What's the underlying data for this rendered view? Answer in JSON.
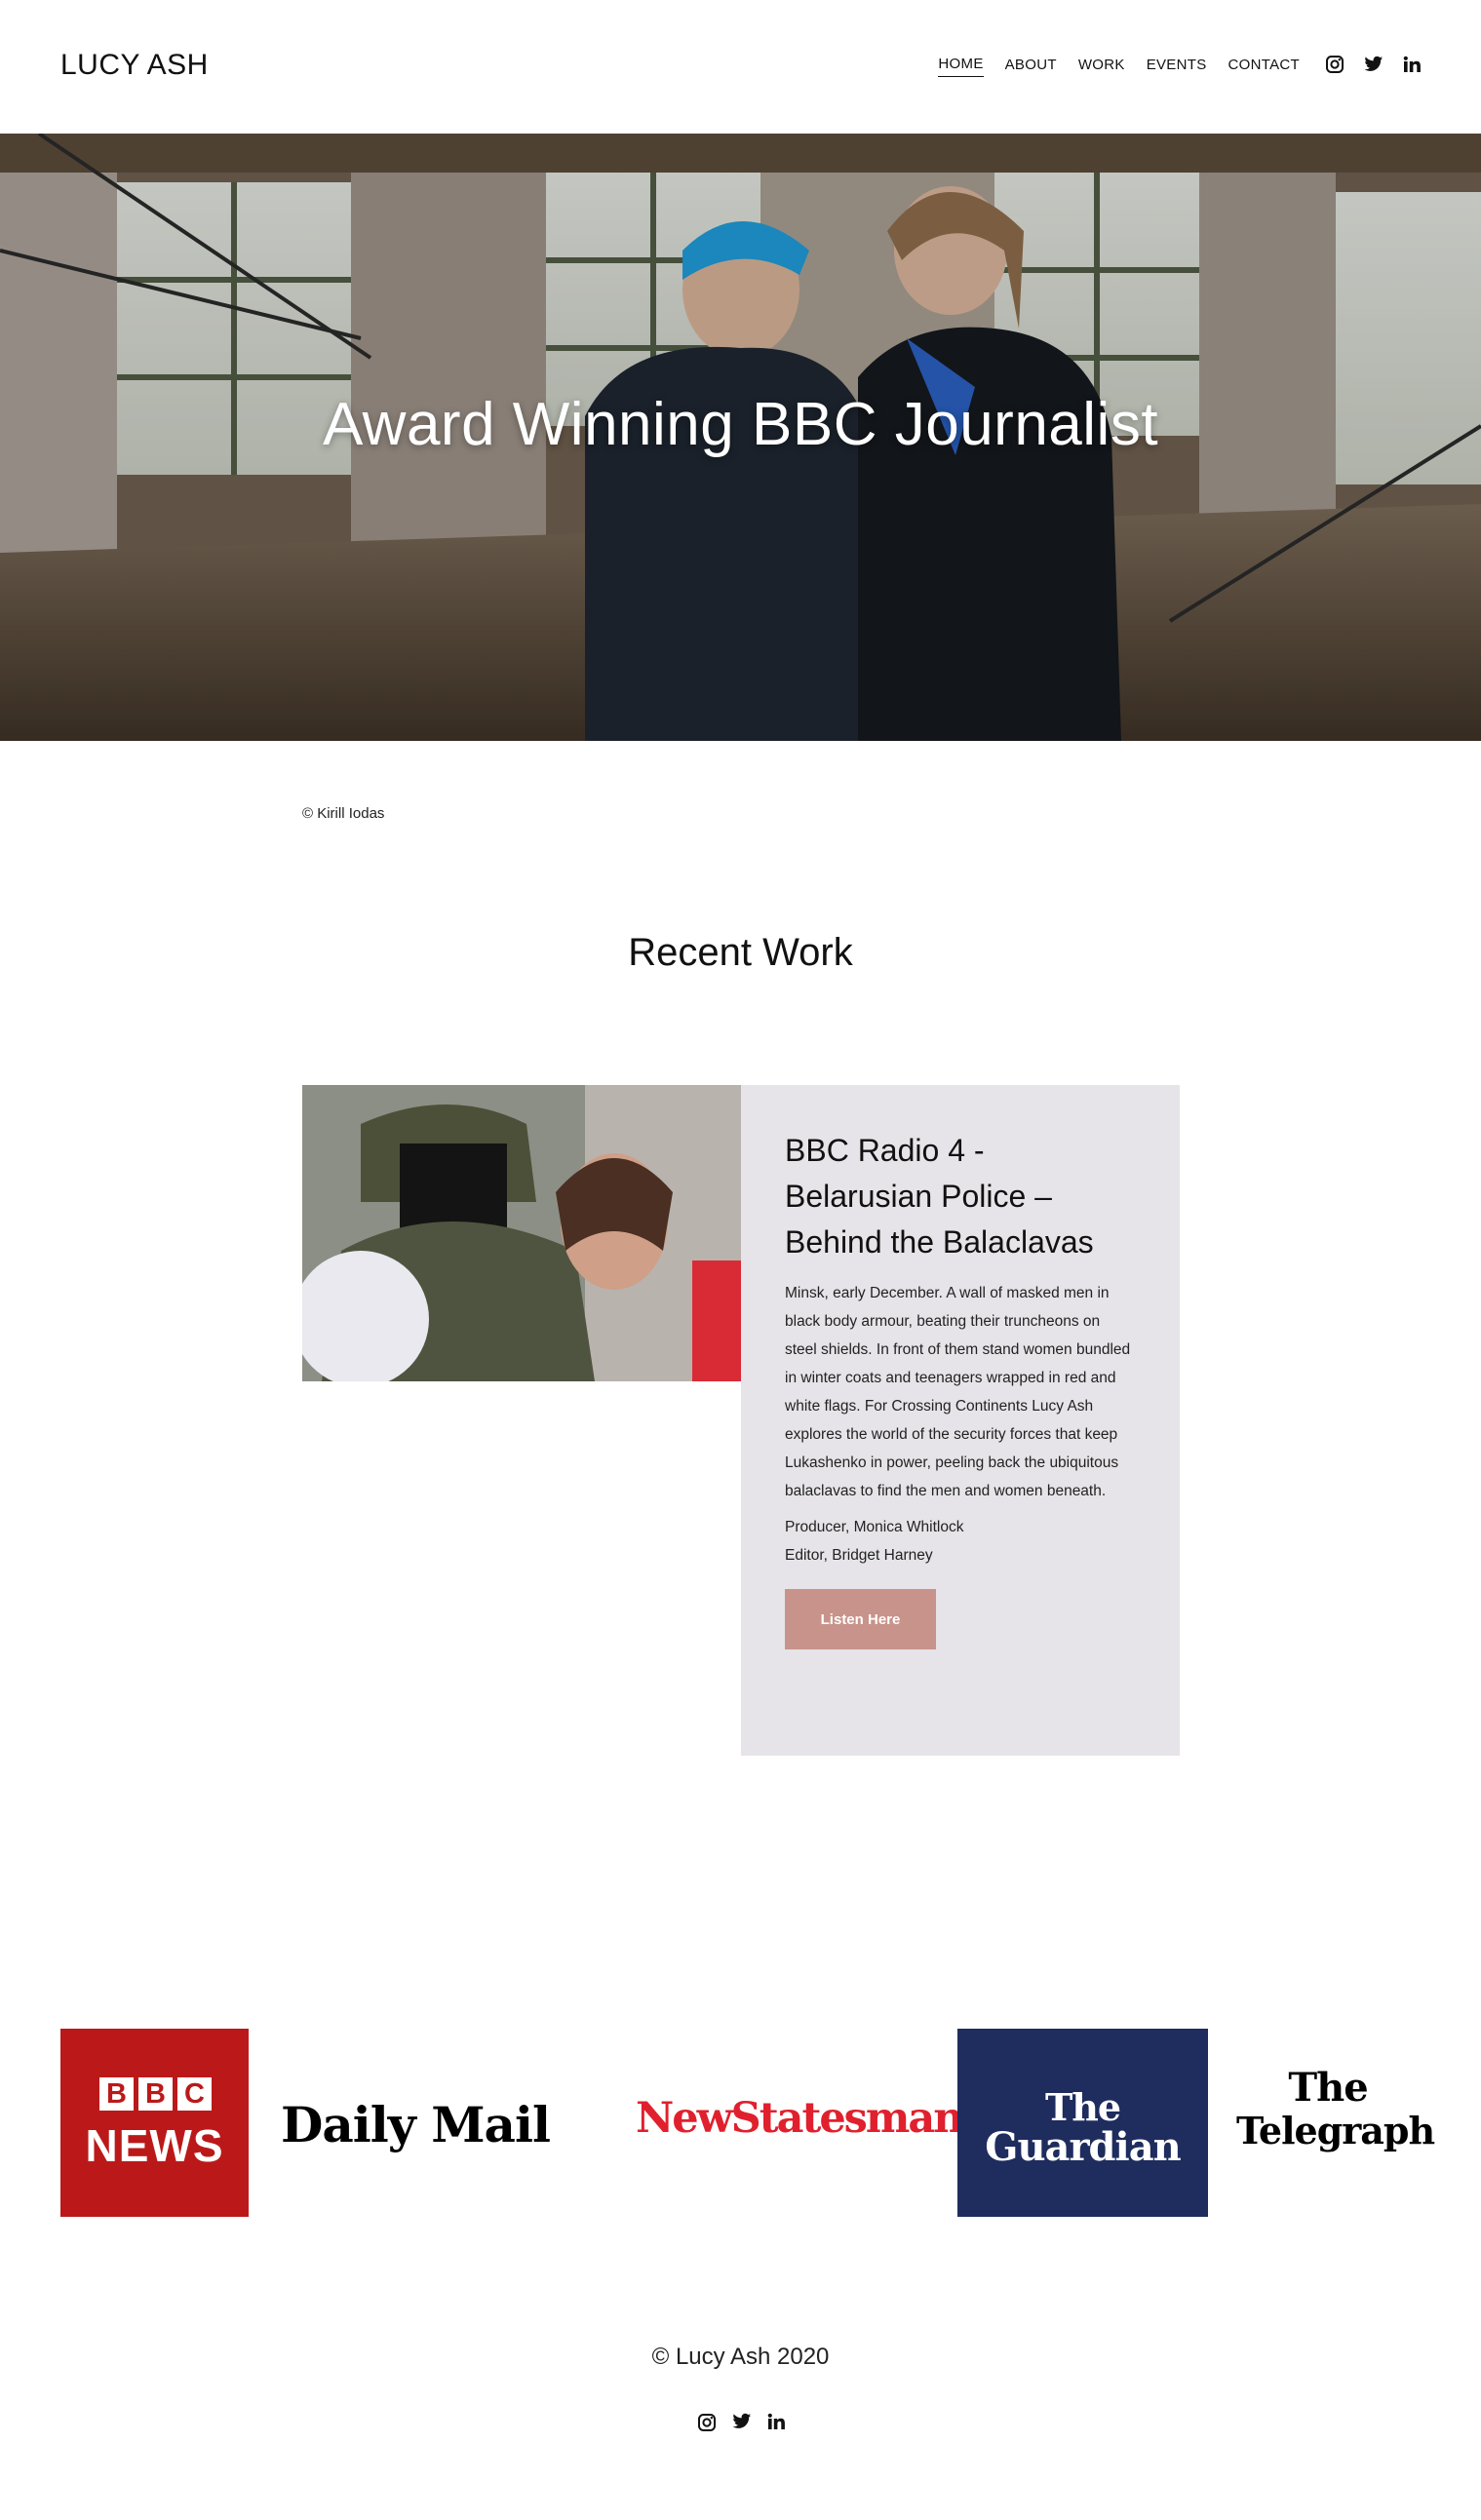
{
  "header": {
    "site_title": "LUCY ASH",
    "nav": [
      {
        "label": "HOME"
      },
      {
        "label": "ABOUT"
      },
      {
        "label": "WORK"
      },
      {
        "label": "EVENTS"
      },
      {
        "label": "CONTACT"
      }
    ],
    "social_icons": [
      "instagram-icon",
      "twitter-icon",
      "linkedin-icon"
    ]
  },
  "hero": {
    "title": "Award Winning BBC Journalist",
    "credit": "© Kirill Iodas"
  },
  "recent_work": {
    "heading": "Recent Work",
    "card": {
      "title": "BBC Radio 4 - Belarusian Police – Behind the Balaclavas",
      "description": "Minsk, early December. A wall of masked men in black body armour, beating their truncheons on steel shields. In front of them stand women bundled in winter coats and teenagers wrapped in red and white flags. For Crossing Continents Lucy Ash explores the world of the security forces that keep Lukashenko in power, peeling back the ubiquitous balaclavas to find the men and women beneath.",
      "producer": "Producer, Monica Whitlock",
      "editor": "Editor, Bridget Harney",
      "button_label": "Listen Here"
    }
  },
  "logos": {
    "bbc": {
      "boxes": [
        "B",
        "B",
        "C"
      ],
      "word": "NEWS"
    },
    "daily_mail": "Daily Mail",
    "new_statesman": "NewStatesman",
    "guardian": [
      "The",
      "Guardian"
    ],
    "telegraph": [
      "The",
      "Telegraph"
    ]
  },
  "footer": {
    "copyright": "© Lucy Ash 2020"
  },
  "colors": {
    "button": "#c8938a",
    "card_bg": "#e6e4e8",
    "bbc_red": "#bb1919",
    "guardian_navy": "#1e2c5e",
    "newstatesman_red": "#e0202d"
  }
}
